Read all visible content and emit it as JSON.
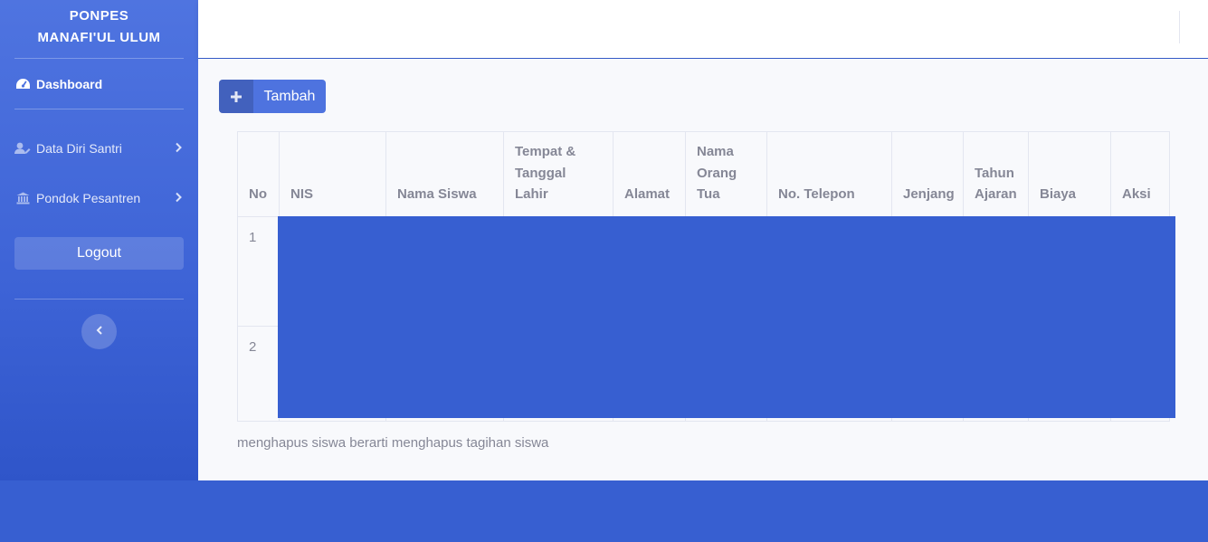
{
  "brand": {
    "line1": "PONPES",
    "line2": "MANAFI'UL ULUM"
  },
  "sidebar": {
    "items": [
      {
        "label": "Dashboard",
        "icon": "tachometer-icon"
      },
      {
        "label": "Data Diri Santri",
        "icon": "user-edit-icon"
      },
      {
        "label": "Pondok Pesantren",
        "icon": "landmark-icon"
      }
    ],
    "logout_label": "Logout"
  },
  "toolbar": {
    "add_label": "Tambah"
  },
  "table": {
    "headers": [
      "No",
      "NIS",
      "Nama Siswa",
      "Tempat & Tanggal Lahir",
      "Alamat",
      "Nama Orang Tua",
      "No. Telepon",
      "Jenjang",
      "Tahun Ajaran",
      "Biaya",
      "Aksi"
    ],
    "rows": [
      {
        "no": "1"
      },
      {
        "no": "2"
      }
    ]
  },
  "note": "menghapus siswa berarti menghapus tagihan siswa",
  "colors": {
    "primary": "#4e73df",
    "overlay": "#375fd1",
    "text_muted": "#858796"
  }
}
